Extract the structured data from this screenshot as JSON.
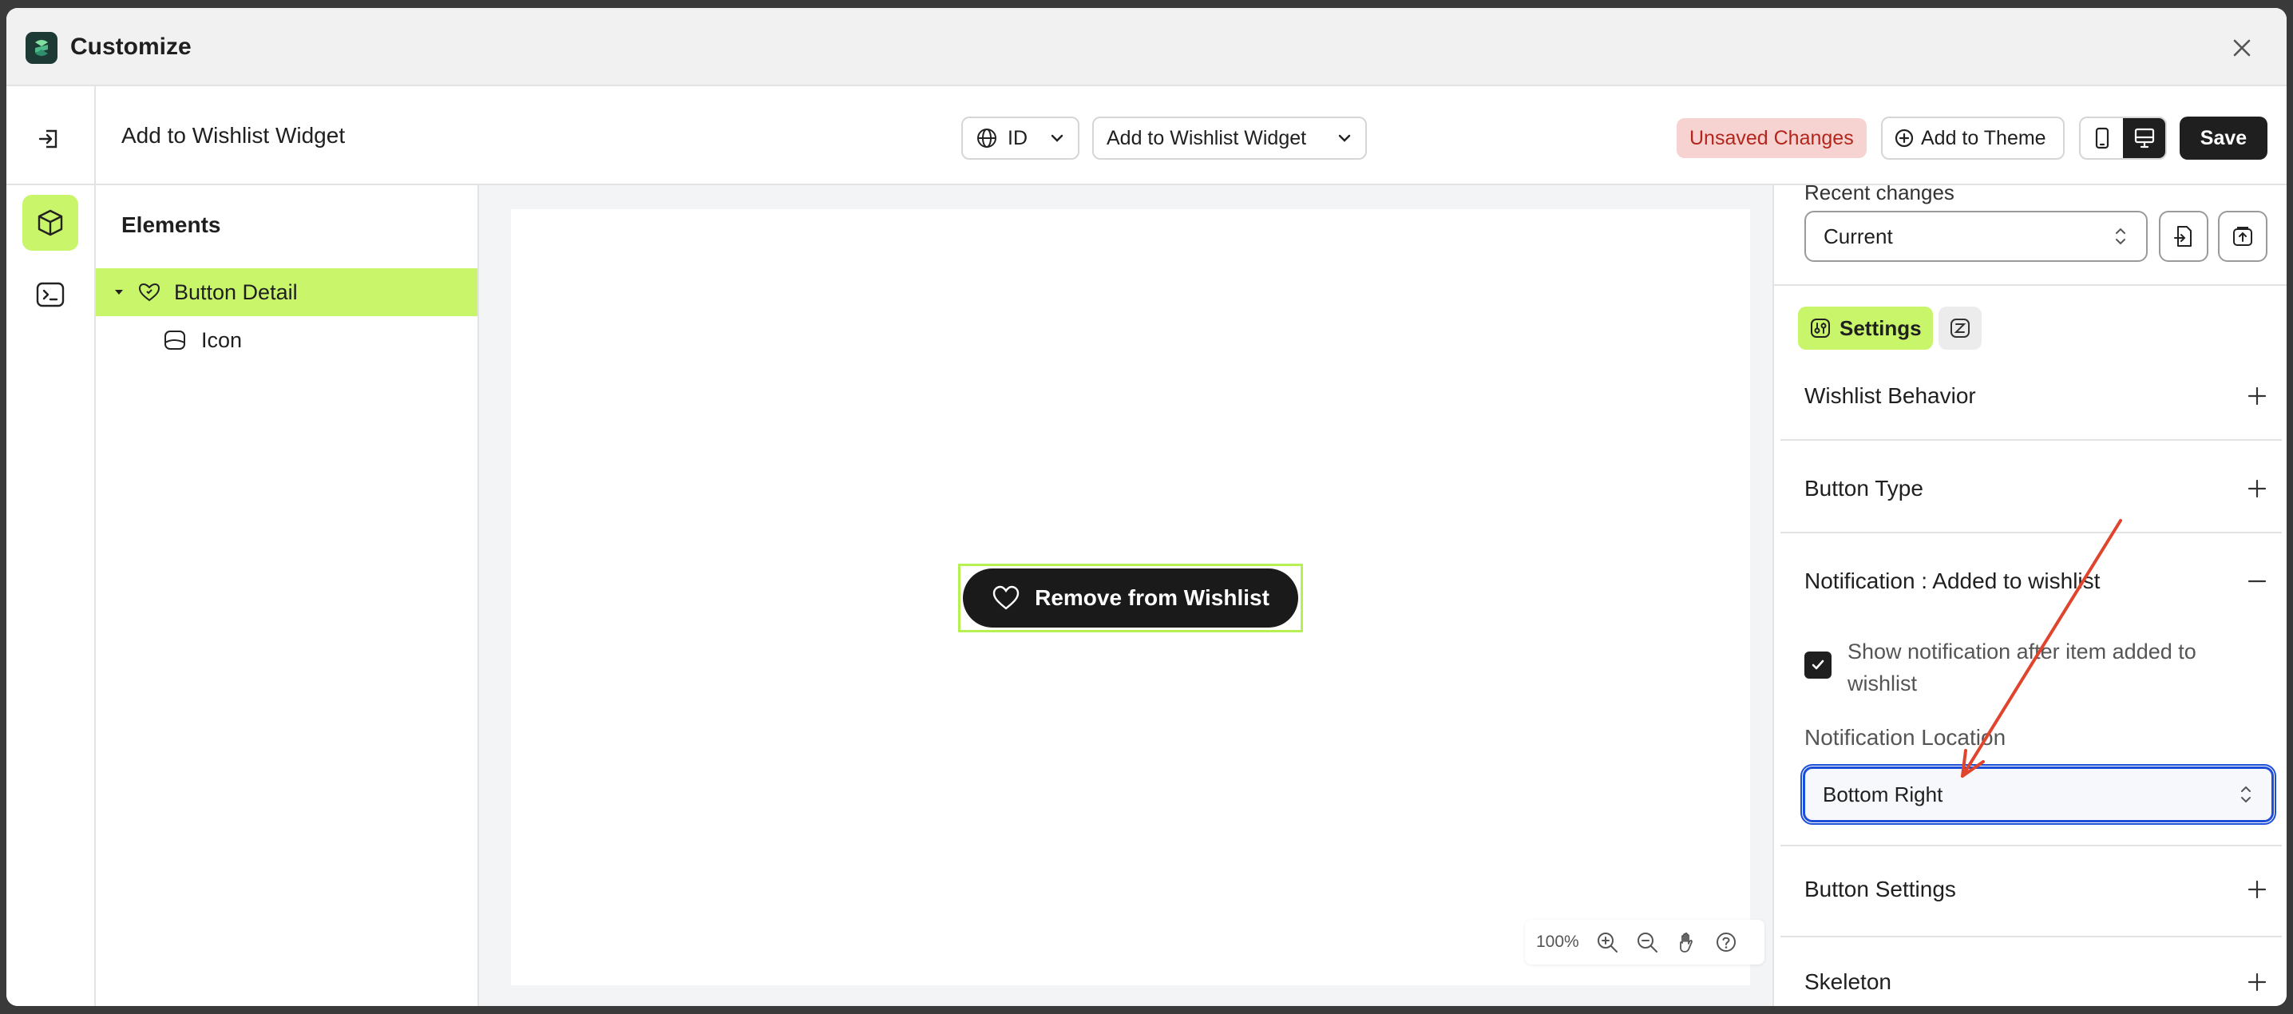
{
  "app": {
    "title": "Customize"
  },
  "header": {
    "page_title": "Add to Wishlist Widget",
    "language": "ID",
    "widget_select": "Add to Wishlist Widget",
    "unsaved_badge": "Unsaved Changes",
    "add_to_theme": "Add to Theme",
    "save": "Save"
  },
  "elements": {
    "title": "Elements",
    "items": [
      {
        "label": "Button Detail",
        "selected": true
      },
      {
        "label": "Icon",
        "selected": false
      }
    ]
  },
  "canvas": {
    "button_label": "Remove from Wishlist",
    "zoom": "100%"
  },
  "settings": {
    "recent_changes_label": "Recent changes",
    "recent_changes_value": "Current",
    "tab_settings": "Settings",
    "sections": {
      "wishlist_behavior": "Wishlist Behavior",
      "button_type": "Button Type",
      "notification_added": "Notification : Added to wishlist",
      "button_settings": "Button Settings",
      "skeleton": "Skeleton"
    },
    "show_notification_label": "Show notification after item added to wishlist",
    "show_notification_checked": true,
    "notification_location_label": "Notification Location",
    "notification_location_value": "Bottom Right"
  },
  "colors": {
    "accent": "#c9f56a",
    "dark": "#1f1f1f",
    "unsaved_bg": "#f6d3d0",
    "unsaved_text": "#b3261e",
    "focus": "#1d4ed8",
    "annotation_arrow": "#e0442d"
  }
}
